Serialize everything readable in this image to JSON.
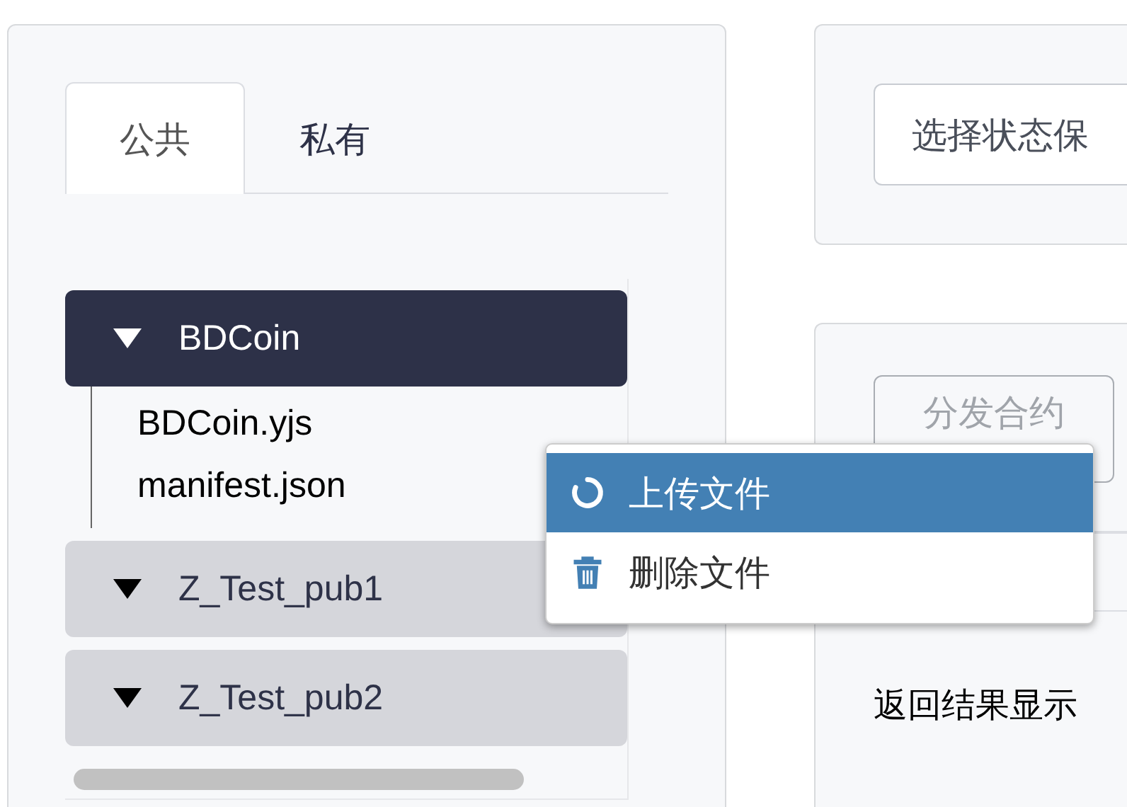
{
  "tabs": [
    {
      "label": "公共",
      "selected": true
    },
    {
      "label": "私有",
      "selected": false
    }
  ],
  "tree": [
    {
      "label": "BDCoin",
      "selected": true,
      "children": [
        {
          "label": "BDCoin.yjs"
        },
        {
          "label": "manifest.json"
        }
      ]
    },
    {
      "label": "Z_Test_pub1",
      "selected": false
    },
    {
      "label": "Z_Test_pub2",
      "selected": false
    }
  ],
  "state_select": {
    "value": "选择状态保"
  },
  "deploy_button": {
    "label": "分发合约",
    "disabled": true
  },
  "result_label": "返回结果显示",
  "context_menu": [
    {
      "kind": "upload",
      "label": "上传文件",
      "selected": true
    },
    {
      "kind": "delete",
      "label": "删除文件",
      "selected": false
    }
  ]
}
